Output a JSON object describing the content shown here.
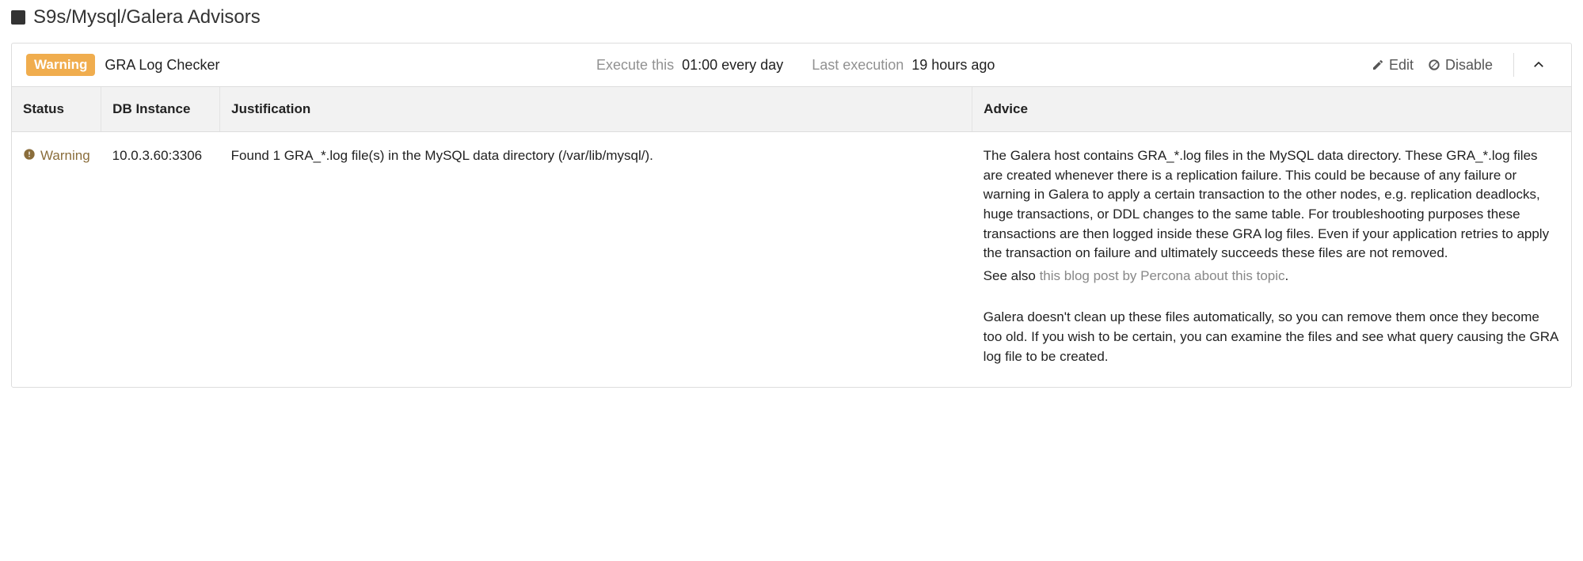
{
  "page": {
    "title": "S9s/Mysql/Galera Advisors"
  },
  "header": {
    "badge": "Warning",
    "advisor_name": "GRA Log Checker",
    "execute_label": "Execute this",
    "execute_value": "01:00 every day",
    "last_exec_label": "Last execution",
    "last_exec_value": "19 hours ago",
    "edit_label": "Edit",
    "disable_label": "Disable"
  },
  "table": {
    "columns": {
      "status": "Status",
      "instance": "DB Instance",
      "justification": "Justification",
      "advice": "Advice"
    },
    "rows": [
      {
        "status": "Warning",
        "instance": "10.0.3.60:3306",
        "justification": "Found 1 GRA_*.log file(s) in the MySQL data directory (/var/lib/mysql/).",
        "advice_p1": "The Galera host contains GRA_*.log files in the MySQL data directory. These GRA_*.log files are created whenever there is a replication failure. This could be because of any failure or warning in Galera to apply a certain transaction to the other nodes, e.g. replication deadlocks, huge transactions, or DDL changes to the same table. For troubleshooting purposes these transactions are then logged inside these GRA log files. Even if your application retries to apply the transaction on failure and ultimately succeeds these files are not removed.",
        "advice_see_also_prefix": "See also ",
        "advice_link_text": "this blog post by Percona about this topic",
        "advice_p2": "Galera doesn't clean up these files automatically, so you can remove them once they become too old. If you wish to be certain, you can examine the files and see what query causing the GRA log file to be created."
      }
    ]
  }
}
